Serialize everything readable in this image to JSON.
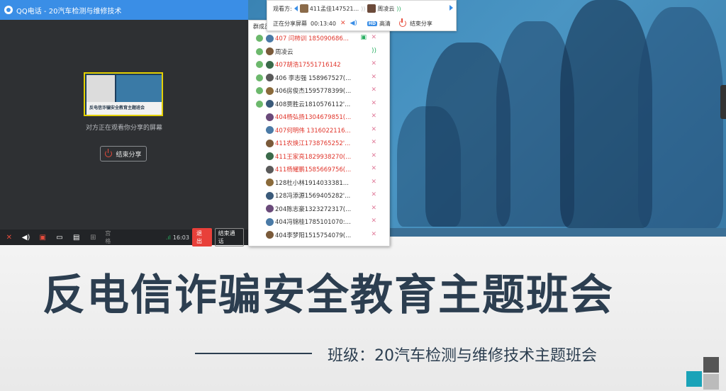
{
  "window": {
    "title": "QQ电话 - 20汽车检测与维修技术",
    "share_caption": "对方正在观看你分享的屏幕",
    "end_share_label": "结束分享",
    "thumb_title": "反电信诈骗安全教育主题班会"
  },
  "toolbar": {
    "grid_label": "宫格",
    "time": "16:03",
    "exit_label": "退出",
    "end_call_label": "结束通话"
  },
  "viewer": {
    "label": "观看方:",
    "viewer1": "411孟佳147521...",
    "viewer2": "周凌云",
    "sharing_label": "正在分享屏幕",
    "elapsed": "00:13:40",
    "hd_badge": "HD",
    "hd_label": "高清",
    "end_share_label": "结束分享"
  },
  "members": {
    "header": "群成员",
    "items": [
      {
        "name": "407 闫柿训  185090686...",
        "color": "red",
        "role": true,
        "extra": "screen"
      },
      {
        "name": "周凌云",
        "color": "dark",
        "role": true,
        "extra": "signal"
      },
      {
        "name": "407胡浩17551716142",
        "color": "red",
        "role": true,
        "extra": ""
      },
      {
        "name": "406 李志强 158967527(...",
        "color": "dark",
        "role": true,
        "extra": ""
      },
      {
        "name": "406房俊杰1595778399(...",
        "color": "dark",
        "role": true,
        "extra": ""
      },
      {
        "name": "408贾胜云1810576112'...",
        "color": "dark",
        "role": true,
        "extra": ""
      },
      {
        "name": "404杨弘扬1304679851(...",
        "color": "red",
        "role": false,
        "extra": ""
      },
      {
        "name": "407何明伟 1316022116...",
        "color": "red",
        "role": false,
        "extra": ""
      },
      {
        "name": "411农焕江1738765252'...",
        "color": "red",
        "role": false,
        "extra": ""
      },
      {
        "name": "411王家亮1829938270(...",
        "color": "red",
        "role": false,
        "extra": ""
      },
      {
        "name": "411杨耀鹏1585669756(...",
        "color": "red",
        "role": false,
        "extra": ""
      },
      {
        "name": "128杜小林1914033381...",
        "color": "dark",
        "role": false,
        "extra": ""
      },
      {
        "name": "128冯添源1569405282'...",
        "color": "dark",
        "role": false,
        "extra": ""
      },
      {
        "name": "204陈志豪1323272317(...",
        "color": "dark",
        "role": false,
        "extra": ""
      },
      {
        "name": "404冯锦桂1785101070:...",
        "color": "dark",
        "role": false,
        "extra": ""
      },
      {
        "name": "404李梦阳1515754079(...",
        "color": "dark",
        "role": false,
        "extra": ""
      }
    ]
  },
  "slide": {
    "title": "反电信诈骗安全教育主题班会",
    "subtitle": "班级：20汽车检测与维修技术主题班会"
  },
  "colors": {
    "accent": "#3a8ee6",
    "danger": "#e8403a",
    "slide_title": "#2c3e50"
  }
}
